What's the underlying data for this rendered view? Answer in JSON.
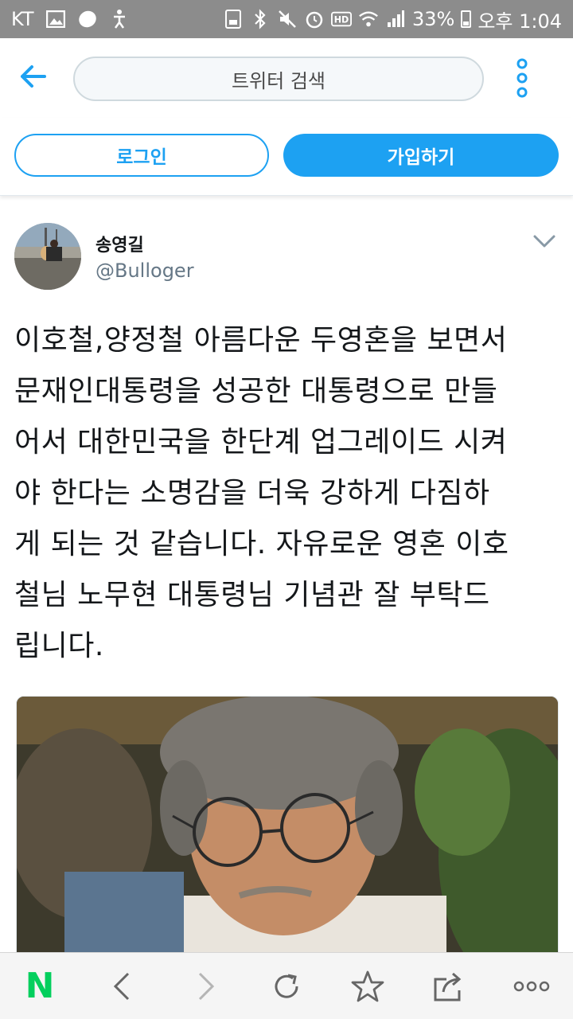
{
  "status_bar": {
    "carrier": "KT",
    "battery_percent": "33%",
    "time": "오후 1:04",
    "icons": [
      "image-icon",
      "egg-icon",
      "accessibility-icon",
      "save-icon",
      "bluetooth-icon",
      "mute-icon",
      "alarm-icon",
      "hd-icon",
      "wifi-icon",
      "signal-icon",
      "battery-icon"
    ]
  },
  "header": {
    "search_placeholder": "트위터 검색",
    "icons": [
      "back-arrow-icon",
      "more-vertical-icon"
    ]
  },
  "auth": {
    "login_label": "로그인",
    "signup_label": "가입하기"
  },
  "tweet": {
    "display_name": "송영길",
    "handle": "@Bulloger",
    "text_lines": [
      "이호철,양정철 아름다운 두영혼을 보면서",
      "문재인대통령을 성공한 대통령으로 만들",
      "어서 대한민국을 한단계 업그레이드 시켜",
      "야 한다는 소명감을 더욱 강하게 다짐하",
      "게 되는 것 같습니다. 자유로운 영혼 이호",
      "철님 노무현 대통령님 기념관 잘 부탁드",
      "립니다."
    ]
  },
  "toolbar": {
    "icons": [
      "naver-n-icon",
      "back-icon",
      "forward-icon",
      "refresh-icon",
      "bookmark-star-icon",
      "share-icon",
      "more-horizontal-icon"
    ],
    "naver_label": "N"
  },
  "colors": {
    "accent": "#1da1f2",
    "status_bar": "#8c8c8c",
    "naver_green": "#03cf5d"
  }
}
